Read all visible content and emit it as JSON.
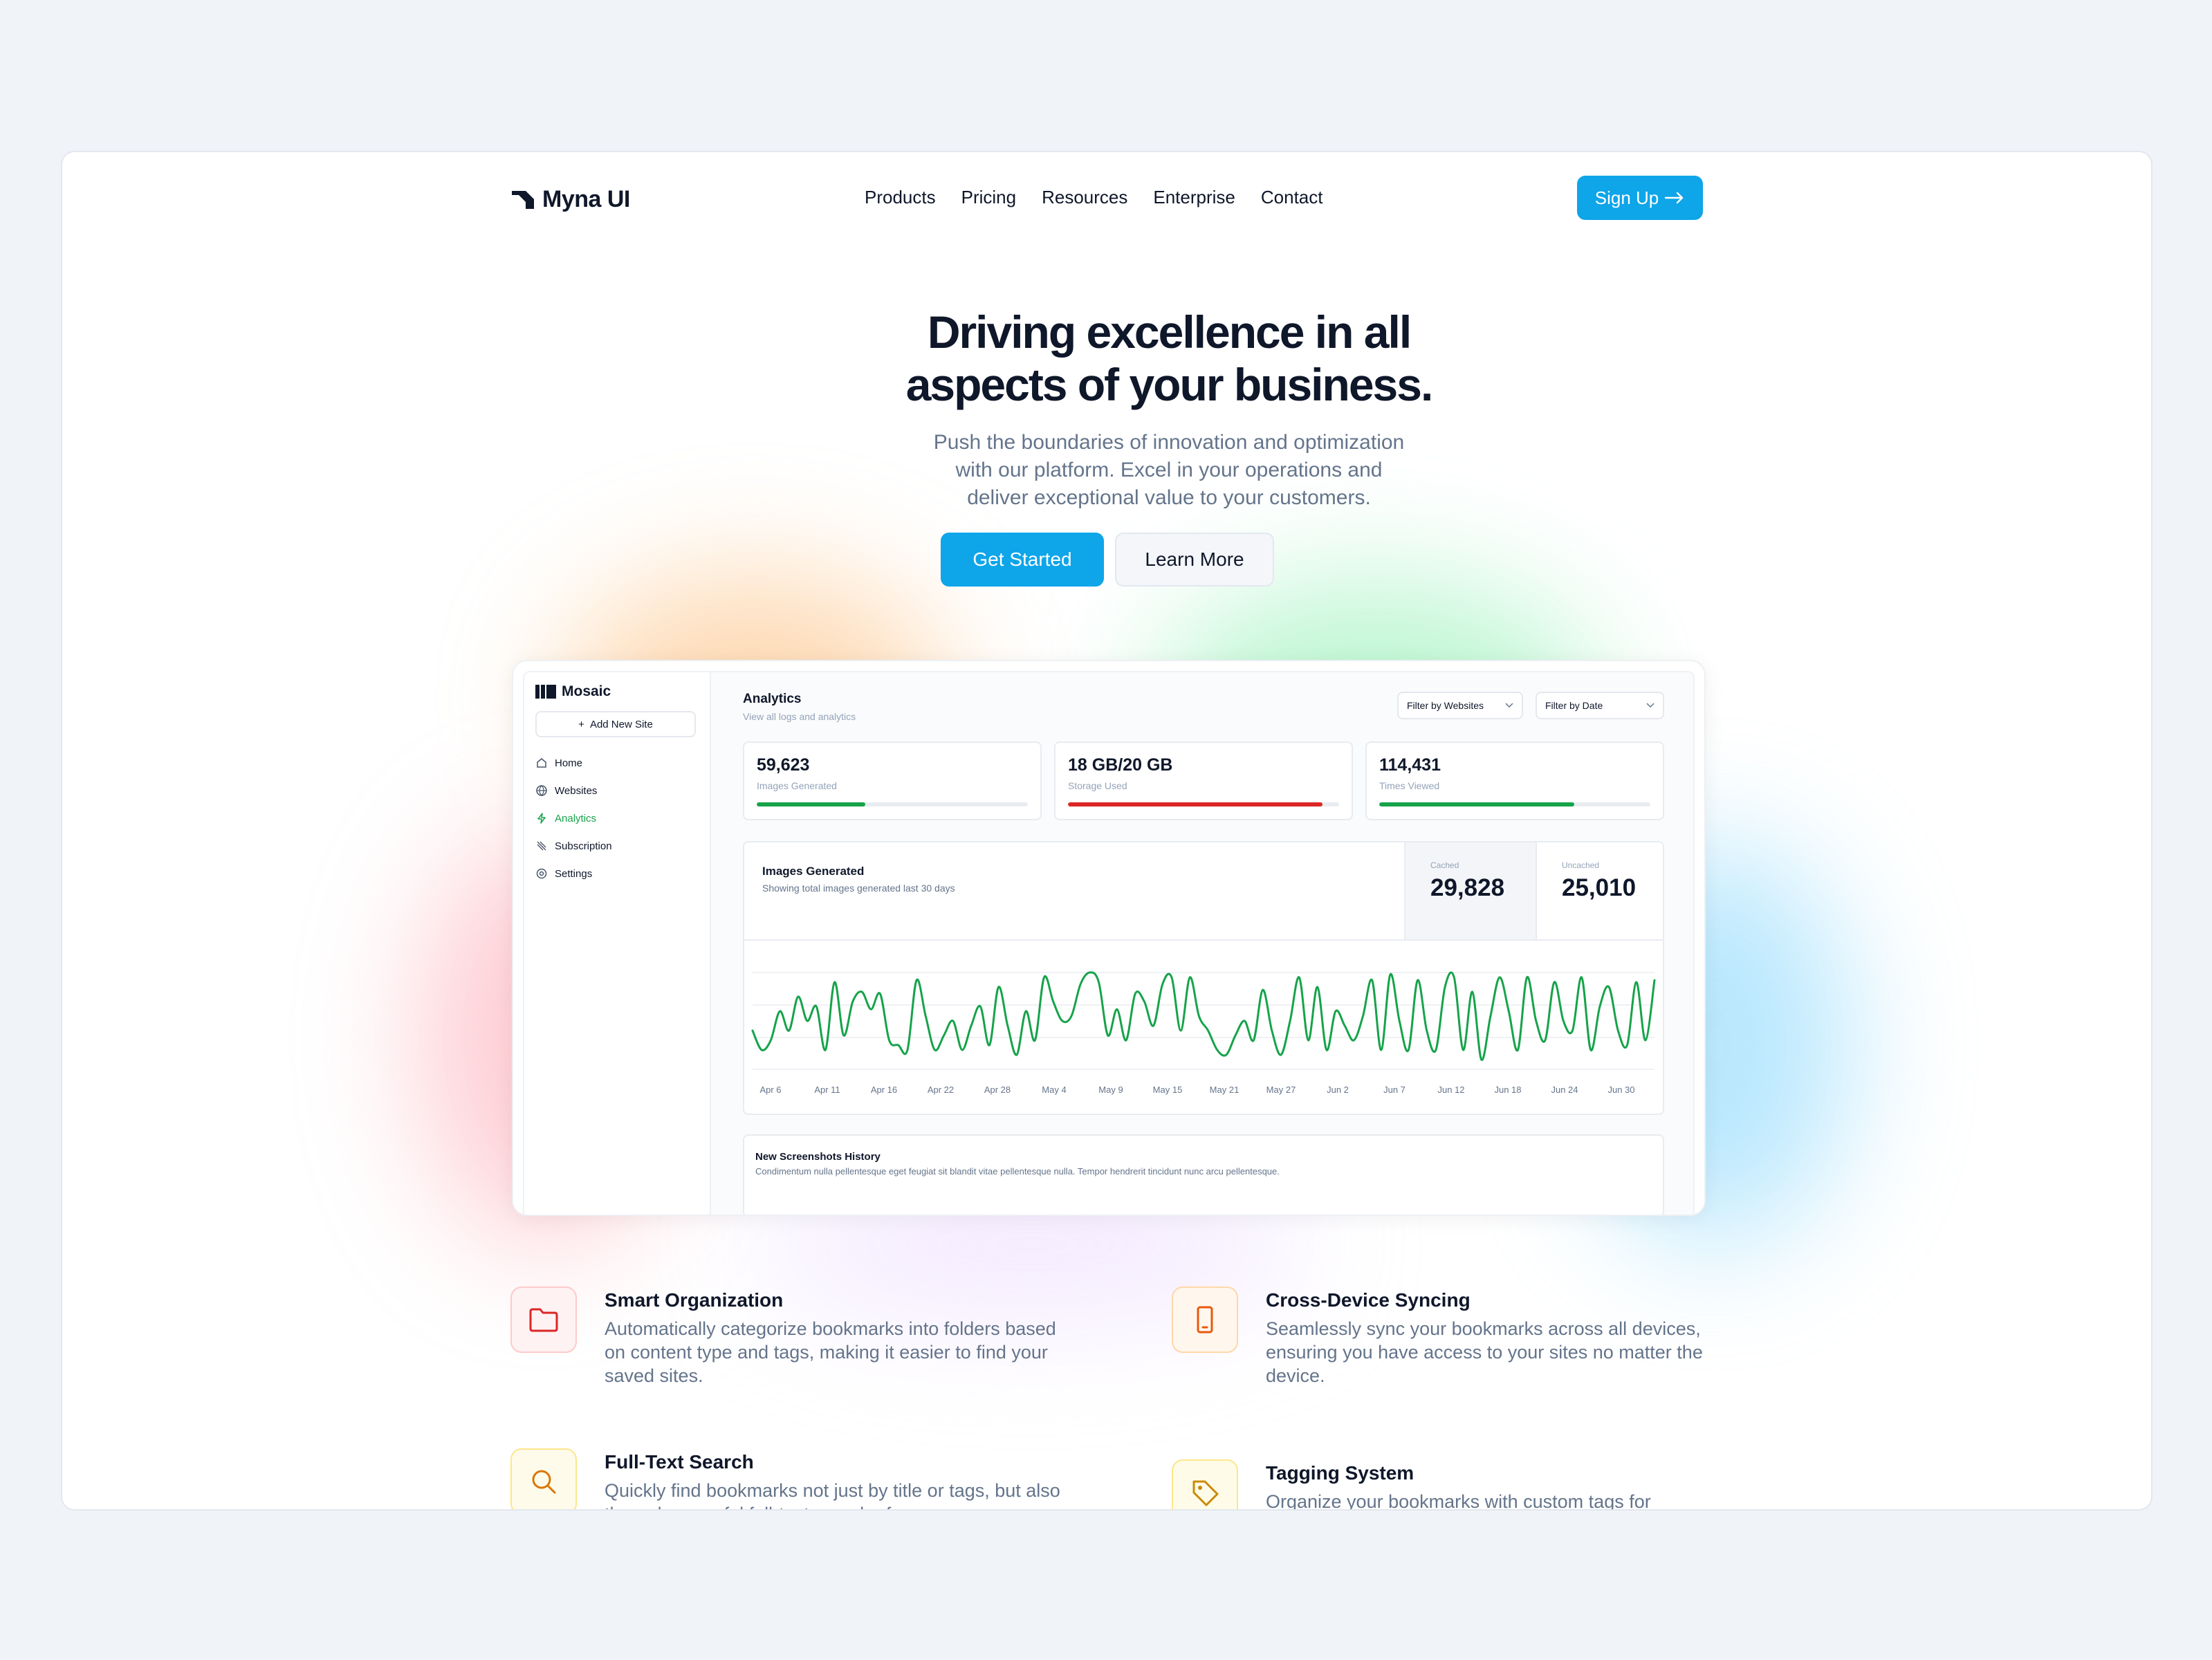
{
  "brand": {
    "name": "Myna UI"
  },
  "nav": {
    "items": [
      "Products",
      "Pricing",
      "Resources",
      "Enterprise",
      "Contact"
    ],
    "signup": "Sign Up"
  },
  "hero": {
    "title_line1": "Driving excellence in all",
    "title_line2": "aspects of your business.",
    "subtitle_line1": "Push the boundaries of innovation and optimization",
    "subtitle_line2": "with our platform. Excel in your operations and",
    "subtitle_line3": "deliver exceptional value to your customers.",
    "primary_cta": "Get Started",
    "secondary_cta": "Learn More"
  },
  "dashboard": {
    "app_name": "Mosaic",
    "add_site": "Add New Site",
    "sidebar": [
      {
        "label": "Home",
        "icon": "home-icon"
      },
      {
        "label": "Websites",
        "icon": "globe-icon"
      },
      {
        "label": "Analytics",
        "icon": "bolt-icon",
        "active": true
      },
      {
        "label": "Subscription",
        "icon": "subscription-icon"
      },
      {
        "label": "Settings",
        "icon": "gear-icon"
      }
    ],
    "title": "Analytics",
    "subtitle": "View all logs and analytics",
    "filters": [
      "Filter by Websites",
      "Filter by Date"
    ],
    "stats": [
      {
        "value": "59,623",
        "label": "Images Generated",
        "progress": 0.4,
        "color": "#16a34a"
      },
      {
        "value": "18 GB/20 GB",
        "label": "Storage Used",
        "progress": 0.94,
        "color": "#dc2626"
      },
      {
        "value": "114,431",
        "label": "Times Viewed",
        "progress": 0.72,
        "color": "#16a34a"
      }
    ],
    "chart_card": {
      "title": "Images Generated",
      "subtitle": "Showing total images generated last 30 days",
      "cached_label": "Cached",
      "cached_value": "29,828",
      "uncached_label": "Uncached",
      "uncached_value": "25,010"
    },
    "history": {
      "title": "New Screenshots History",
      "subtitle": "Condimentum nulla pellentesque eget feugiat sit blandit vitae pellentesque nulla. Tempor hendrerit tincidunt nunc arcu pellentesque."
    }
  },
  "chart_data": {
    "type": "line",
    "line_color": "#16a34a",
    "x_tick_labels": [
      "Apr 6",
      "Apr 11",
      "Apr 16",
      "Apr 22",
      "Apr 28",
      "May 4",
      "May 9",
      "May 15",
      "May 21",
      "May 27",
      "Jun 2",
      "Jun 7",
      "Jun 12",
      "Jun 18",
      "Jun 24",
      "Jun 30"
    ],
    "values": [
      0.4,
      0.2,
      0.3,
      0.6,
      0.4,
      0.75,
      0.5,
      0.65,
      0.2,
      0.9,
      0.35,
      0.7,
      0.8,
      0.62,
      0.78,
      0.3,
      0.25,
      0.2,
      0.92,
      0.55,
      0.2,
      0.35,
      0.5,
      0.2,
      0.45,
      0.65,
      0.25,
      0.85,
      0.45,
      0.15,
      0.6,
      0.3,
      0.95,
      0.7,
      0.5,
      0.55,
      0.88,
      1.0,
      0.9,
      0.35,
      0.62,
      0.3,
      0.78,
      0.7,
      0.45,
      0.88,
      0.95,
      0.4,
      0.95,
      0.55,
      0.4,
      0.2,
      0.15,
      0.35,
      0.5,
      0.3,
      0.82,
      0.4,
      0.15,
      0.5,
      0.95,
      0.3,
      0.85,
      0.2,
      0.6,
      0.45,
      0.3,
      0.55,
      0.92,
      0.2,
      0.98,
      0.5,
      0.2,
      0.92,
      0.4,
      0.2,
      0.85,
      0.95,
      0.2,
      0.8,
      0.1,
      0.55,
      0.95,
      0.6,
      0.2,
      0.95,
      0.5,
      0.3,
      0.9,
      0.5,
      0.4,
      0.95,
      0.2,
      0.65,
      0.85,
      0.4,
      0.25,
      0.9,
      0.3,
      0.92
    ]
  },
  "features": [
    {
      "title": "Smart Organization",
      "desc": "Automatically categorize bookmarks into folders based on content type and tags, making it easier to find your saved sites.",
      "icon": "folder-icon"
    },
    {
      "title": "Cross-Device Syncing",
      "desc": "Seamlessly sync your bookmarks across all devices, ensuring you have access to your sites no matter the device.",
      "icon": "phone-icon"
    },
    {
      "title": "Full-Text Search",
      "desc": "Quickly find bookmarks not just by title or tags, but also through powerful full-text search of",
      "icon": "search-icon"
    },
    {
      "title": "Tagging System",
      "desc": "Organize your bookmarks with custom tags for",
      "icon": "tag-icon"
    }
  ]
}
